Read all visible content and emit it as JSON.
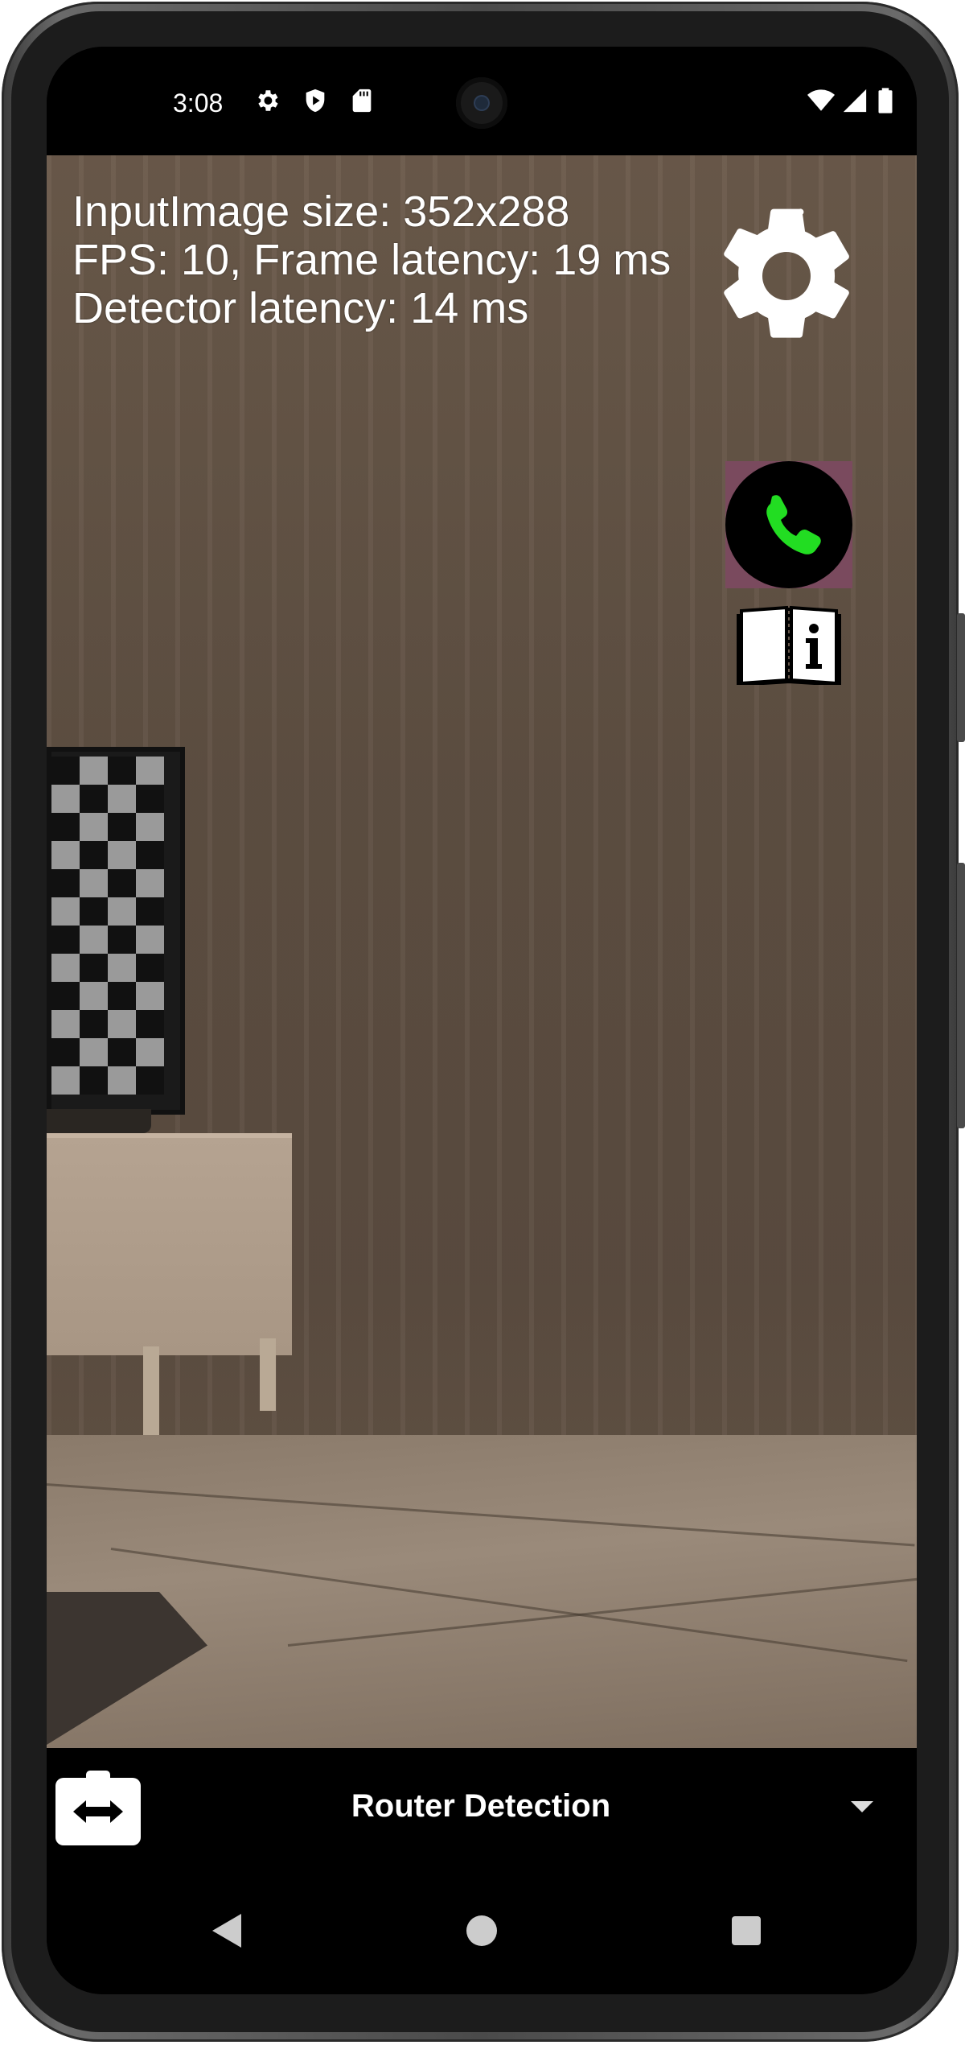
{
  "status_bar": {
    "time": "3:08",
    "left_icons": [
      "gear-icon",
      "shield-play-icon",
      "sd-card-icon"
    ],
    "right_icons": [
      "wifi-icon",
      "cellular-signal-icon",
      "battery-icon"
    ]
  },
  "overlay": {
    "input_image_size": "InputImage size: 352x288",
    "fps_latency": "FPS: 10, Frame latency: 19 ms",
    "detector_latency": "Detector latency: 14 ms"
  },
  "buttons": {
    "settings_icon": "gear-icon",
    "call_icon": "phone-call-icon",
    "guide_icon": "info-book-icon",
    "call_button_color": "#7a4a5e",
    "call_phone_color": "#22dd22"
  },
  "control_bar": {
    "switch_camera_icon": "switch-camera-icon",
    "selected_mode": "Router Detection"
  },
  "nav_bar": {
    "icons": [
      "back-icon",
      "home-icon",
      "recents-icon"
    ]
  }
}
